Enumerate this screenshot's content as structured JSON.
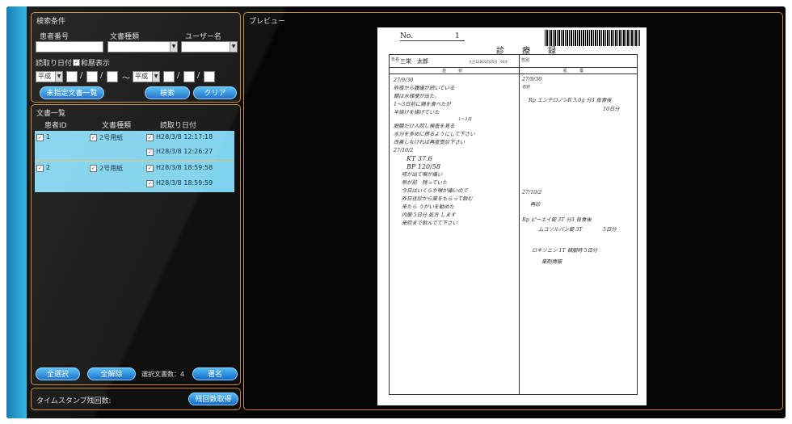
{
  "search": {
    "title": "検索条件",
    "patient_no_label": "患者番号",
    "doc_type_label": "文書種類",
    "user_name_label": "ユーザー名",
    "read_date_label": "読取り日付",
    "wareki_label": "和暦表示",
    "era_from": "平成",
    "era_to": "平成",
    "range_sep": "～",
    "date_sep": "/",
    "btn_unassigned": "未指定文書一覧",
    "btn_search": "検索",
    "btn_clear": "クリア"
  },
  "doclist": {
    "title": "文書一覧",
    "col_patient": "患者ID",
    "col_type": "文書種類",
    "col_date": "読取り日付",
    "groups": [
      {
        "patient": "1",
        "type": "2号用紙",
        "dates": [
          "H28/3/8 12:17:18",
          "H28/3/8 12:26:27"
        ]
      },
      {
        "patient": "2",
        "type": "2号用紙",
        "dates": [
          "H28/3/8 18:59:58",
          "H28/3/8 18:59:59"
        ]
      }
    ],
    "btn_select_all": "全選択",
    "btn_deselect_all": "全解除",
    "selected_label": "選択文書数：4",
    "btn_sign": "署名"
  },
  "timestamp": {
    "label": "タイムスタンプ残回数:",
    "btn_get": "残回数取得"
  },
  "preview": {
    "title": "プレビュー",
    "doc": {
      "no_label": "No.",
      "no_value": "1",
      "heading": "診　療　録",
      "name_label": "氏名",
      "name_value": "三栄　太郎",
      "birth": "大正12年02月05日　93才",
      "sex_label": "性別",
      "col_symptom": "症　　　状",
      "col_treatment": "処　　　置",
      "left_notes": [
        "27/9/30",
        "昨夜から腹痛が続いている",
        "朝は水様便が出た。",
        "1～3日前に鶏を食べたが",
        "半焼けを揚げていた",
        "1～3日",
        "脱腸だけ入院し検査を見る",
        "水分を多めに摂るようにして下さい",
        "改善しなければ再度受診下さい",
        "27/10/2",
        "KT 37.6",
        "BP 120/58",
        "咳が出て喉が痛い",
        "熱が前　残っていた",
        "今日はいくらか喉が痛いので",
        "昨日往診から薬をもらって飲む",
        "来たら うがいを勧めた",
        "内服 5日分 処方 します",
        "来院まで飲んでて下さい"
      ],
      "right_notes": [
        "27/9/30",
        "初診",
        "Rp エンテロノンR 3.0g 分3 毎食後",
        "10日分",
        "27/10/2",
        "再診",
        "Rp ピーエイ錠 3T 分3 毎食後",
        "ムコソルバン錠 3T",
        "5日分",
        "ロキソニン 1T 頓服時 5日分",
        "薬剤情報"
      ]
    }
  },
  "colors": {
    "accent": "#36b6e4",
    "panel_border": "#c7892c",
    "selected_row": "#7fd2ec",
    "button": "#1669c8"
  }
}
